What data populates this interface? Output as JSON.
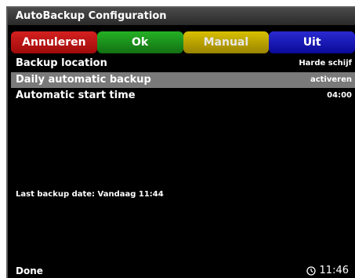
{
  "window": {
    "title": "AutoBackup Configuration"
  },
  "buttons": {
    "red": "Annuleren",
    "green": "Ok",
    "yellow": "Manual",
    "blue": "Uit"
  },
  "settings": [
    {
      "label": "Backup location",
      "value": "Harde schijf"
    },
    {
      "label": "Daily automatic backup",
      "value": "activeren"
    },
    {
      "label": "Automatic start time",
      "value": "04:00"
    }
  ],
  "last_backup": "Last backup date: Vandaag 11:44",
  "status": "Done",
  "clock": "11:46",
  "colors": {
    "red": "#c01515",
    "green": "#1c961c",
    "yellow": "#c0a800",
    "blue": "#1414c0",
    "selected_row": "#7a7a7a"
  },
  "icons": {
    "clock": "clock-icon"
  }
}
